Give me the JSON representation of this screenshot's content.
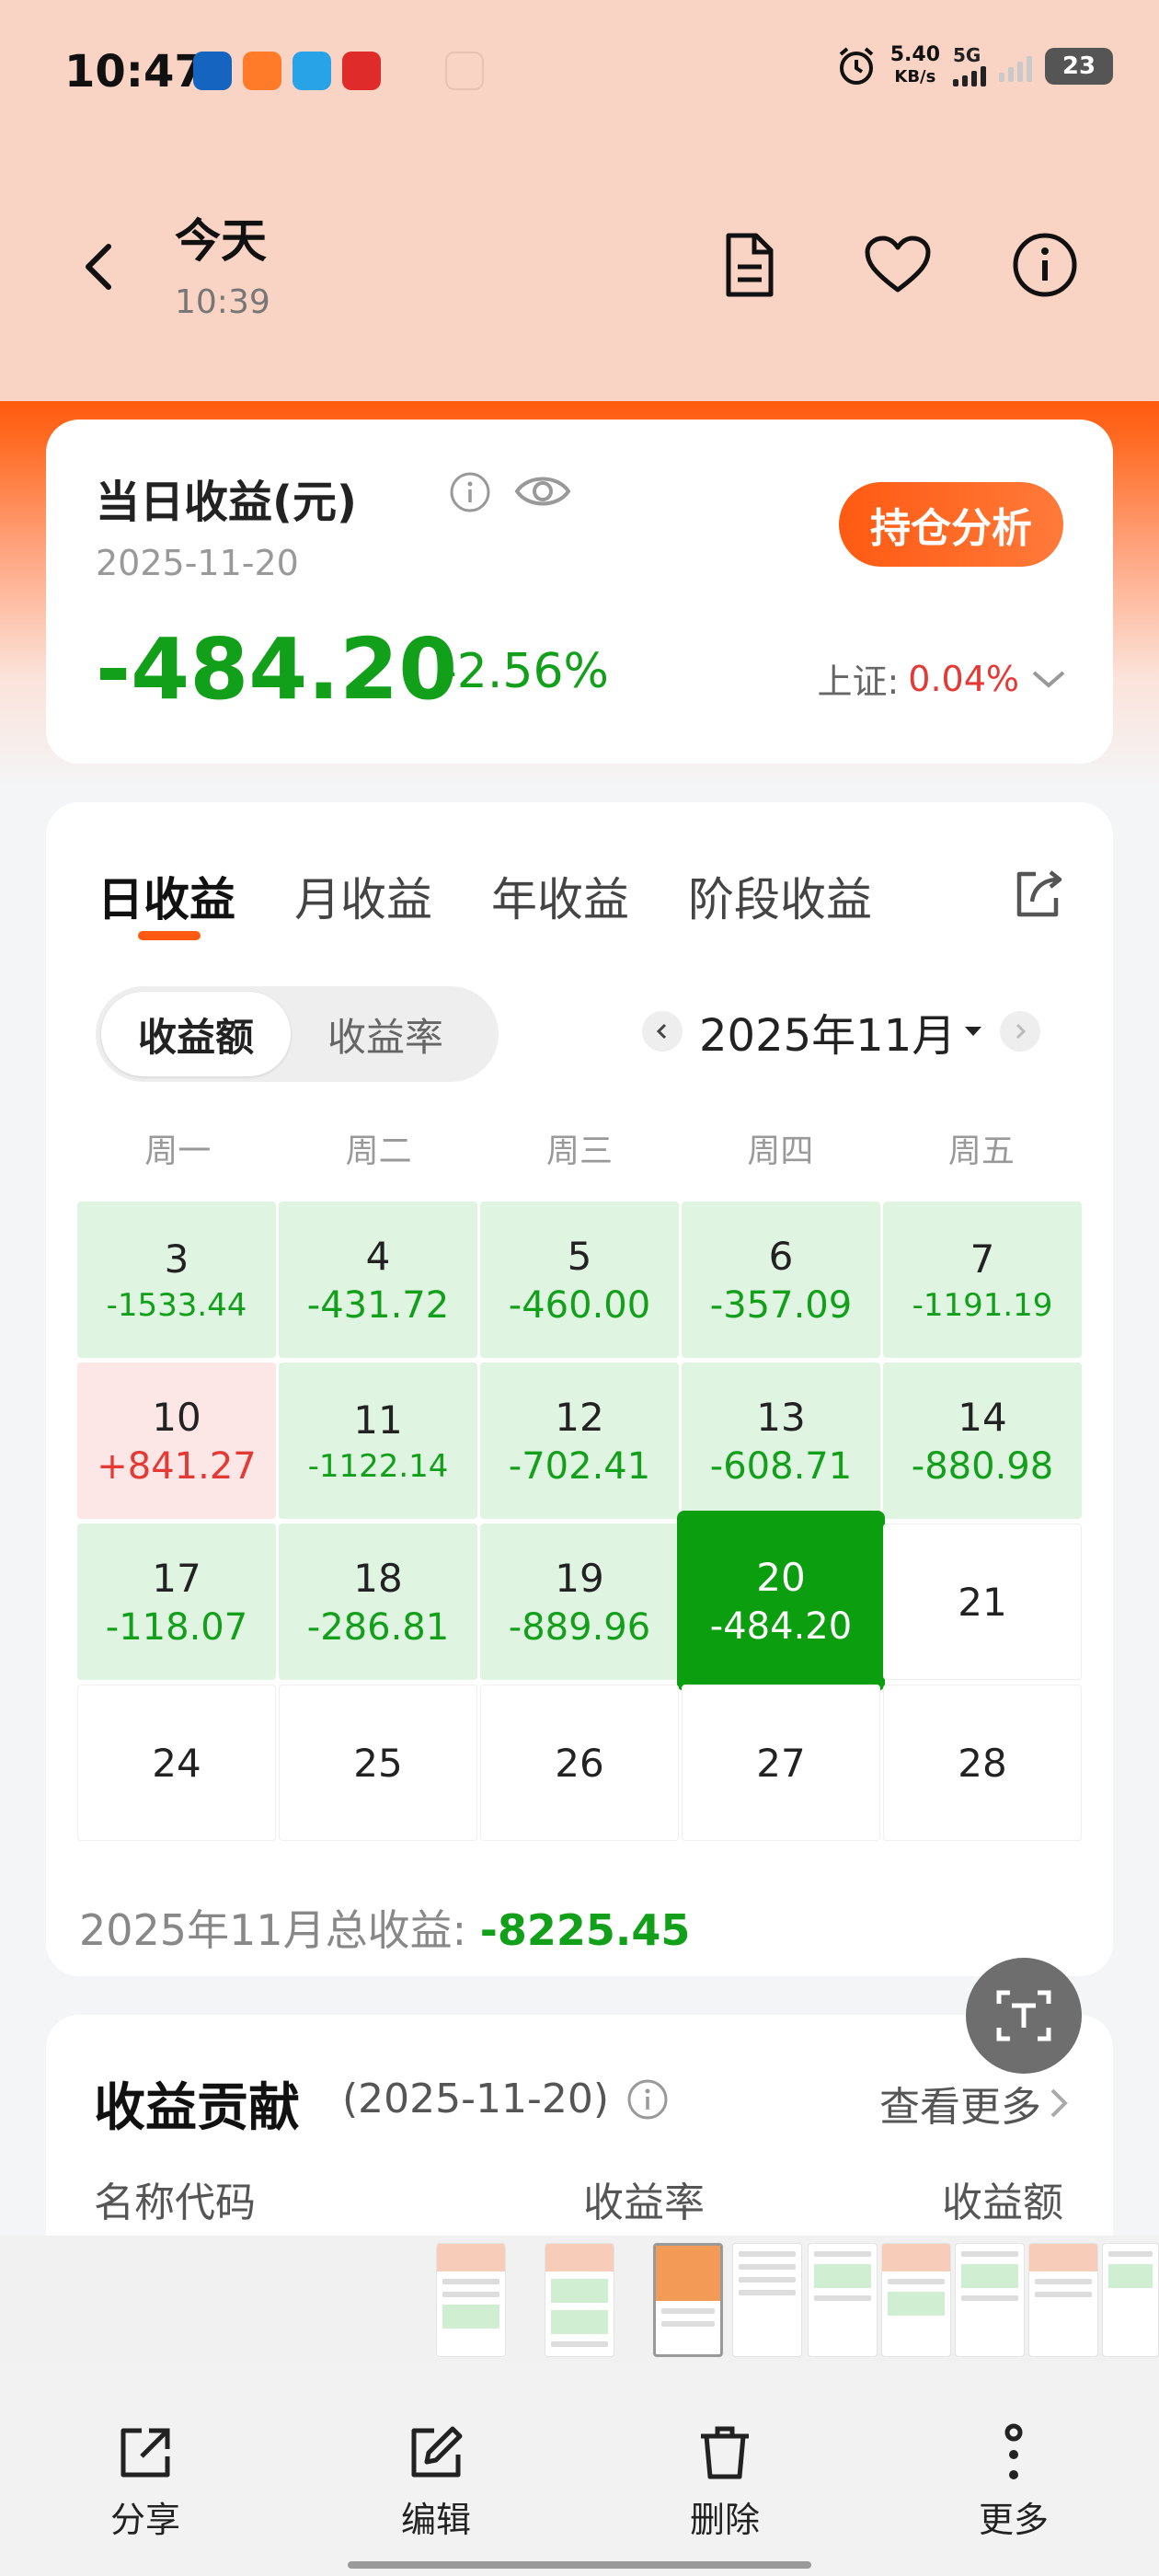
{
  "status_bar": {
    "time": "10:47",
    "network_speed": "5.40",
    "network_unit": "KB/s",
    "network_type": "5G",
    "battery": "23"
  },
  "header": {
    "title": "今天",
    "subtitle": "10:39"
  },
  "summary": {
    "title": "当日收益(元)",
    "date": "2025-11-20",
    "value": "-484.20",
    "percent": "-2.56%",
    "analysis_button": "持仓分析",
    "index_label": "上证:",
    "index_value": "0.04%"
  },
  "calendar": {
    "tabs": [
      "日收益",
      "月收益",
      "年收益",
      "阶段收益"
    ],
    "segment": {
      "amount": "收益额",
      "rate": "收益率"
    },
    "month_label": "2025年11月",
    "weekdays": [
      "周一",
      "周二",
      "周三",
      "周四",
      "周五"
    ],
    "cells": [
      {
        "day": "3",
        "value": "-1533.44"
      },
      {
        "day": "4",
        "value": "-431.72"
      },
      {
        "day": "5",
        "value": "-460.00"
      },
      {
        "day": "6",
        "value": "-357.09"
      },
      {
        "day": "7",
        "value": "-1191.19"
      },
      {
        "day": "10",
        "value": "+841.27"
      },
      {
        "day": "11",
        "value": "-1122.14"
      },
      {
        "day": "12",
        "value": "-702.41"
      },
      {
        "day": "13",
        "value": "-608.71"
      },
      {
        "day": "14",
        "value": "-880.98"
      },
      {
        "day": "17",
        "value": "-118.07"
      },
      {
        "day": "18",
        "value": "-286.81"
      },
      {
        "day": "19",
        "value": "-889.96"
      },
      {
        "day": "20",
        "value": "-484.20"
      },
      {
        "day": "21",
        "value": ""
      },
      {
        "day": "24",
        "value": ""
      },
      {
        "day": "25",
        "value": ""
      },
      {
        "day": "26",
        "value": ""
      },
      {
        "day": "27",
        "value": ""
      },
      {
        "day": "28",
        "value": ""
      }
    ],
    "total_label": "2025年11月总收益:",
    "total_value": "-8225.45"
  },
  "contribution": {
    "title": "收益贡献",
    "date": "(2025-11-20)",
    "more": "查看更多",
    "columns": [
      "名称代码",
      "收益率",
      "收益额"
    ]
  },
  "bottom_bar": {
    "share": "分享",
    "edit": "编辑",
    "delete": "删除",
    "more": "更多"
  },
  "colors": {
    "loss_green": "#12a01a",
    "gain_red": "#e53935",
    "accent_orange": "#ff5a12",
    "header_peach": "#f9d3c3"
  }
}
